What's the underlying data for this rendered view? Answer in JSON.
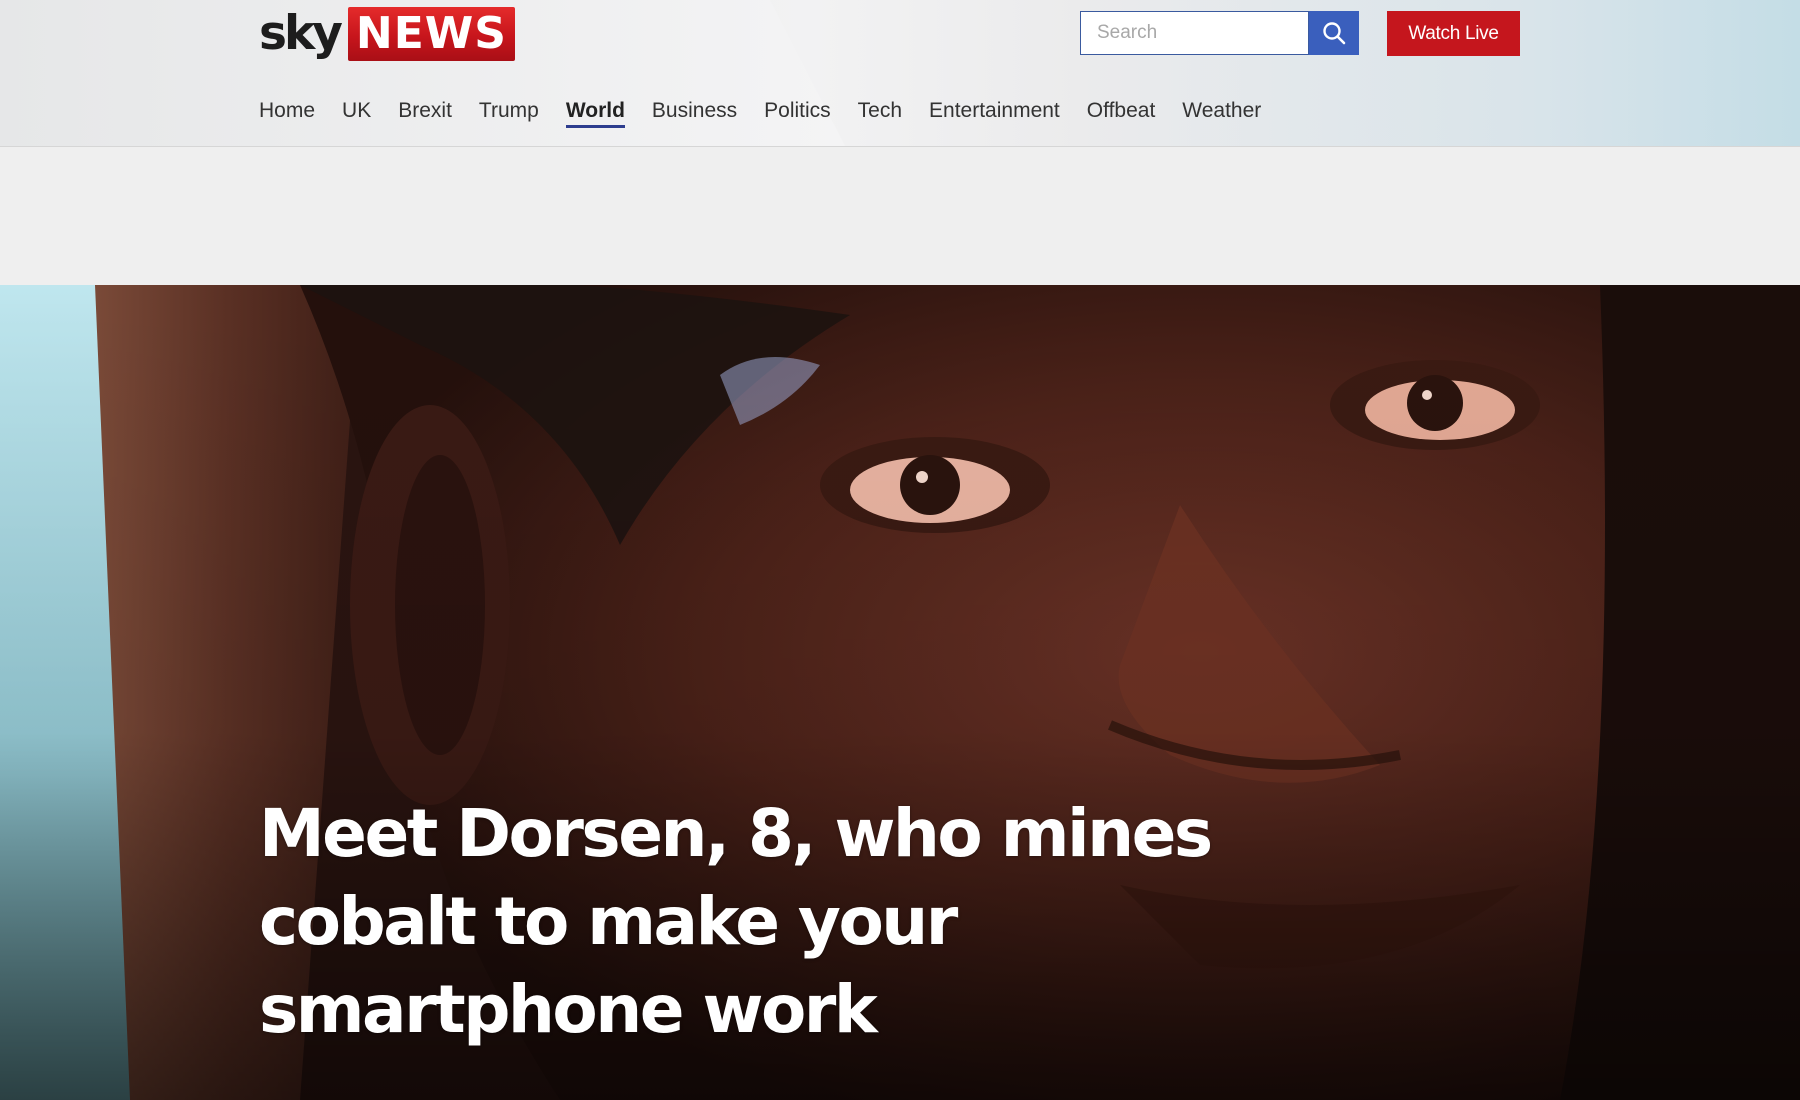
{
  "brand": {
    "logo_text": "sky NEWS",
    "colors": {
      "news_red": "#c5161d",
      "search_blue": "#3a5fbd",
      "nav_active_underline": "#2d3d8e"
    }
  },
  "search": {
    "placeholder": "Search",
    "icon": "search-icon"
  },
  "header": {
    "watch_live_label": "Watch Live"
  },
  "nav": {
    "active": "World",
    "items": [
      "Home",
      "UK",
      "Brexit",
      "Trump",
      "World",
      "Business",
      "Politics",
      "Tech",
      "Entertainment",
      "Offbeat",
      "Weather"
    ]
  },
  "hero": {
    "headline": "Meet Dorsen, 8, who mines cobalt to make your smartphone work",
    "image": "close-up photo of a child's face"
  }
}
